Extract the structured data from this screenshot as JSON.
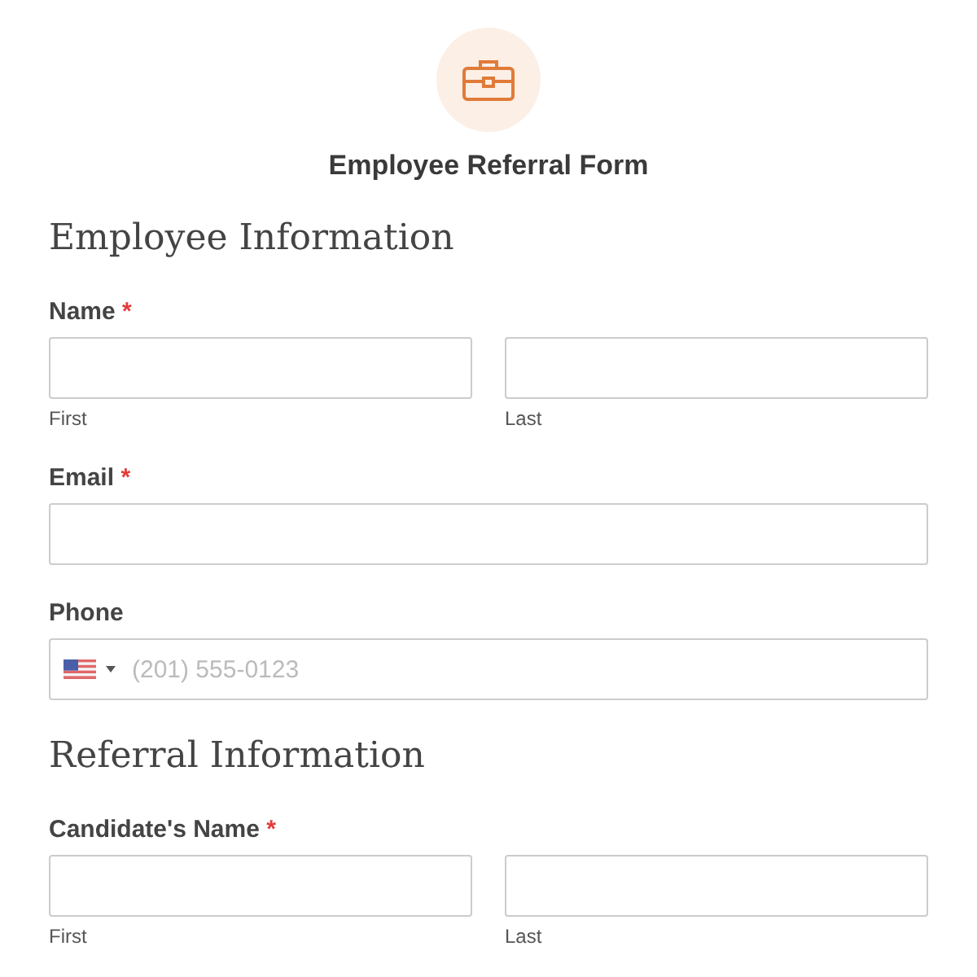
{
  "form": {
    "title": "Employee Referral Form"
  },
  "sections": [
    {
      "heading": "Employee Information",
      "fields": [
        {
          "kind": "name",
          "label": "Name",
          "required_mark": "*",
          "parts": [
            {
              "caption": "First"
            },
            {
              "caption": "Last"
            }
          ]
        },
        {
          "kind": "email",
          "label": "Email",
          "required_mark": "*"
        },
        {
          "kind": "phone",
          "label": "Phone",
          "placeholder": "(201) 555-0123"
        }
      ]
    },
    {
      "heading": "Referral Information",
      "fields": [
        {
          "kind": "name",
          "label": "Candidate's Name",
          "required_mark": "*",
          "parts": [
            {
              "caption": "First"
            },
            {
              "caption": "Last"
            }
          ]
        }
      ]
    }
  ]
}
